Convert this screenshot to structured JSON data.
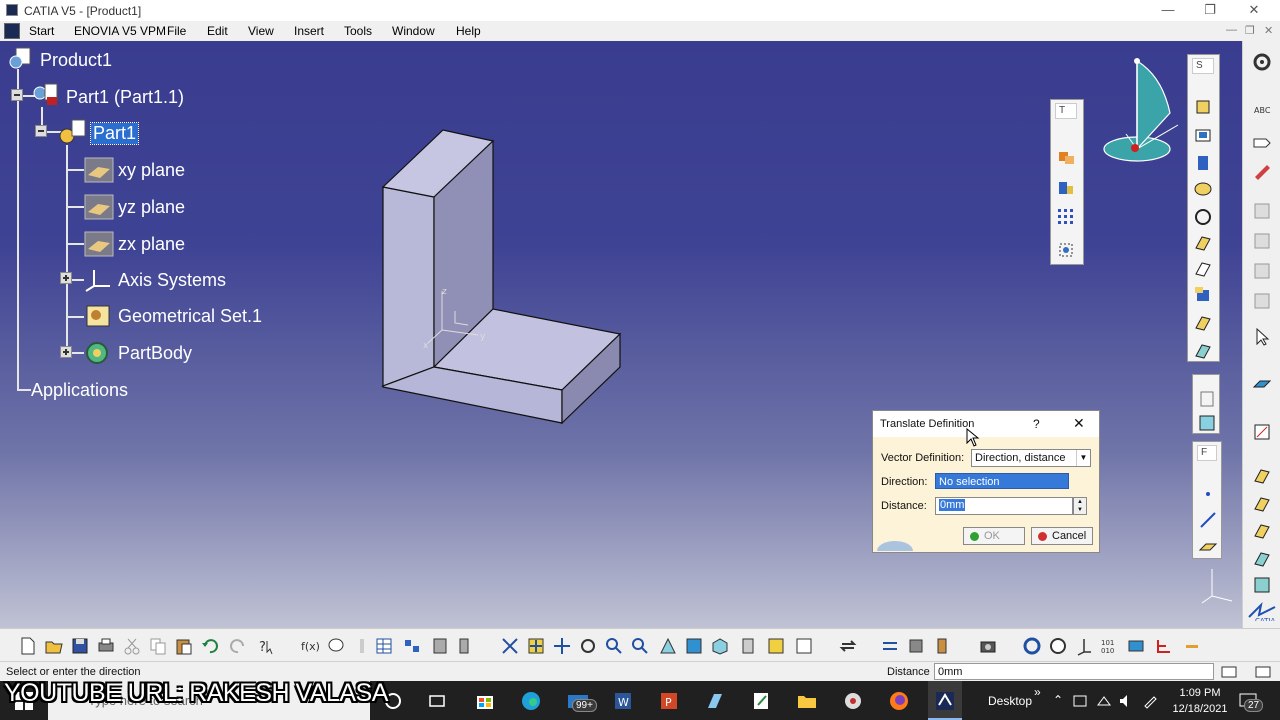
{
  "window": {
    "title": "CATIA V5 - [Product1]"
  },
  "menu": {
    "items": [
      "Start",
      "ENOVIA V5 VPM",
      "File",
      "Edit",
      "View",
      "Insert",
      "Tools",
      "Window",
      "Help"
    ]
  },
  "tree": {
    "root": "Product1",
    "part_instance": "Part1 (Part1.1)",
    "part": "Part1",
    "planes": [
      "xy plane",
      "yz plane",
      "zx plane"
    ],
    "axis_systems": "Axis Systems",
    "geometrical_set": "Geometrical Set.1",
    "part_body": "PartBody",
    "applications": "Applications"
  },
  "axis_labels": {
    "z": "z",
    "x": "x",
    "y": "y"
  },
  "floating_toolbars": {
    "t_title": "T",
    "s_title": "S",
    "f_title": "F"
  },
  "dialog": {
    "title": "Translate Definition",
    "help": "?",
    "close": "✕",
    "vector_label": "Vector Definition:",
    "vector_value": "Direction, distance",
    "direction_label": "Direction:",
    "direction_value": "No selection",
    "distance_label": "Distance:",
    "distance_value": "0mm",
    "ok_label": "OK",
    "cancel_label": "Cancel"
  },
  "status": {
    "message": "Select or enter the direction",
    "distance_label": "Distance",
    "distance_value": "0mm"
  },
  "taskbar": {
    "search_placeholder": "Type here to search",
    "desktop_label": "Desktop",
    "time": "1:09 PM",
    "date": "12/18/2021",
    "mail_badge": "99+",
    "notification_count": "27"
  },
  "overlay": {
    "text": "YOUTUBE URL: RAKESH VALASA"
  },
  "colors": {
    "viewport_top": "#3a3d8f",
    "selection": "#2a6fd0",
    "dialog_bg": "#fdf3d9"
  }
}
